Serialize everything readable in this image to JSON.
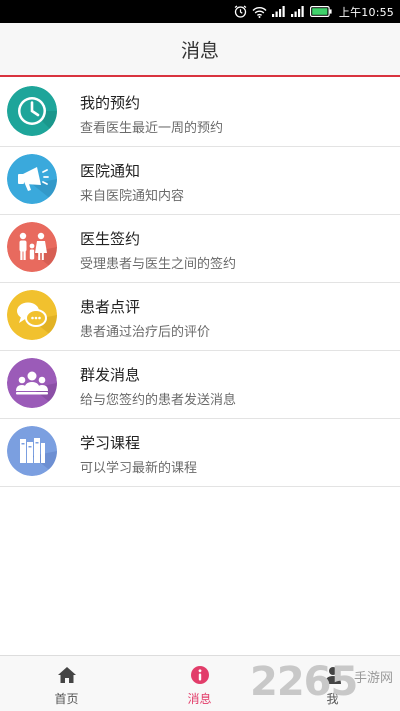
{
  "status_bar": {
    "time": "上午10:55",
    "icons": [
      "alarm-icon",
      "wifi-icon",
      "signal-icon",
      "signal-icon",
      "battery-icon"
    ]
  },
  "header": {
    "title": "消息"
  },
  "list": {
    "items": [
      {
        "title": "我的预约",
        "subtitle": "查看医生最近一周的预约",
        "icon": "clock-icon",
        "color": "#1ea59a"
      },
      {
        "title": "医院通知",
        "subtitle": "来自医院通知内容",
        "icon": "megaphone-icon",
        "color": "#3aa9dc"
      },
      {
        "title": "医生签约",
        "subtitle": "受理患者与医生之间的签约",
        "icon": "family-icon",
        "color": "#e86a5e"
      },
      {
        "title": "患者点评",
        "subtitle": "患者通过治疗后的评价",
        "icon": "chat-bubble-icon",
        "color": "#f1c12e"
      },
      {
        "title": "群发消息",
        "subtitle": "给与您签约的患者发送消息",
        "icon": "group-icon",
        "color": "#9b5bb8"
      },
      {
        "title": "学习课程",
        "subtitle": "可以学习最新的课程",
        "icon": "books-icon",
        "color": "#7b9fe0"
      }
    ]
  },
  "bottom_nav": {
    "tabs": [
      {
        "label": "首页",
        "icon": "home-icon",
        "active": false
      },
      {
        "label": "消息",
        "icon": "info-icon",
        "active": true
      },
      {
        "label": "我",
        "icon": "user-icon",
        "active": false
      }
    ],
    "active_color": "#e23d6a"
  },
  "watermark": {
    "number": "2265",
    "text": "手游网"
  },
  "colors": {
    "header_divider": "#d9333f"
  }
}
